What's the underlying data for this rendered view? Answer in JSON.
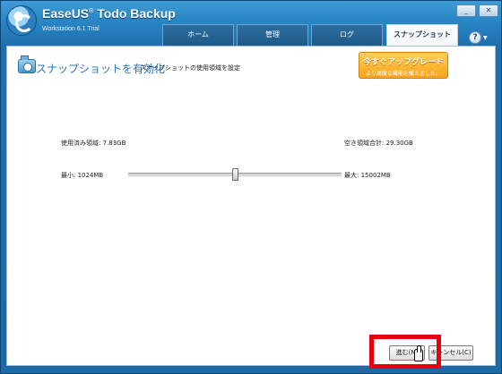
{
  "app": {
    "title_brand": "EaseUS",
    "title_registered": "®",
    "title_product": " Todo Backup",
    "subtitle": "Workstation 6.1 Trial"
  },
  "window_buttons": {
    "minimize": "_",
    "close": "✕"
  },
  "tabs": [
    {
      "label": "ホーム",
      "active": false
    },
    {
      "label": "管理",
      "active": false
    },
    {
      "label": "ログ",
      "active": false
    },
    {
      "label": "スナップショット",
      "active": true
    }
  ],
  "help": {
    "label": "?",
    "caret": "▼"
  },
  "page": {
    "title": "スナップショットを有効化",
    "description": "スナップショットの使用領域を設定"
  },
  "upgrade": {
    "label": "今すぐアップグレード",
    "sublabel": "より高度な機能を備えました。"
  },
  "storage": {
    "used_label": "使用済み領域: 7.83GB",
    "free_label": "空き領域合計: 29.30GB",
    "min_label": "最小: 1024MB",
    "max_label": "最大: 15002MB",
    "slider_value_fraction": 0.5
  },
  "buttons": {
    "next": "進む(N)",
    "cancel": "キャンセル(C)"
  },
  "colors": {
    "accent": "#2a74b8",
    "upgrade": "#f7a21b",
    "highlight": "#e8000e"
  }
}
